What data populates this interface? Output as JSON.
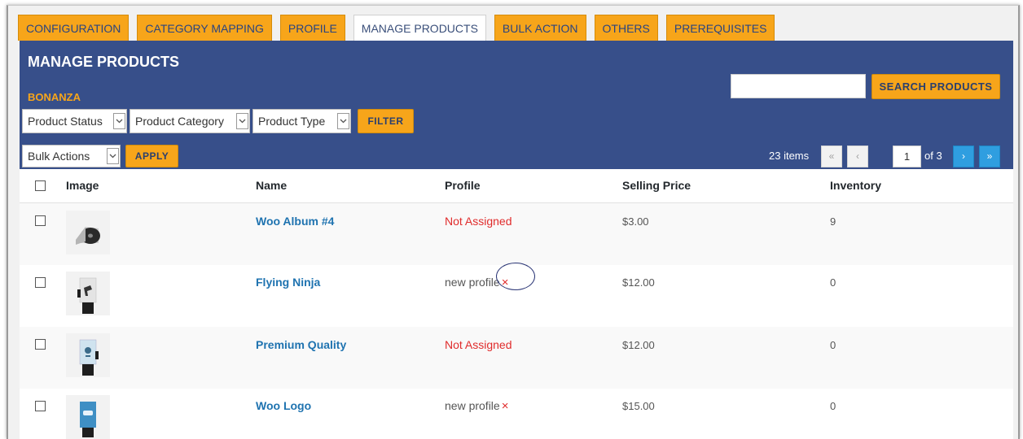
{
  "tabs": [
    {
      "label": "CONFIGURATION"
    },
    {
      "label": "CATEGORY MAPPING"
    },
    {
      "label": "PROFILE"
    },
    {
      "label": "MANAGE PRODUCTS",
      "active": true
    },
    {
      "label": "BULK ACTION"
    },
    {
      "label": "OTHERS"
    },
    {
      "label": "PREREQUISITES"
    }
  ],
  "panel": {
    "title": "MANAGE PRODUCTS",
    "subtitle": "BONANZA",
    "search_value": "",
    "search_button": "SEARCH PRODUCTS",
    "filters": {
      "status": "Product Status",
      "category": "Product Category",
      "type": "Product Type",
      "filter_button": "FILTER"
    },
    "bulk": {
      "select": "Bulk Actions",
      "apply_button": "APPLY"
    },
    "pagination": {
      "items": "23 items",
      "first": "«",
      "prev": "‹",
      "current": "1",
      "of_total": "of 3",
      "next": "›",
      "last": "»"
    }
  },
  "table": {
    "headers": {
      "image": "Image",
      "name": "Name",
      "profile": "Profile",
      "price": "Selling Price",
      "inventory": "Inventory"
    },
    "rows": [
      {
        "name": "Woo Album #4",
        "profile": "Not Assigned",
        "assigned": false,
        "price": "$3.00",
        "inventory": "9",
        "thumb": "album-thumbnail"
      },
      {
        "name": "Flying Ninja",
        "profile": "new profile",
        "assigned": true,
        "remove": "×",
        "price": "$12.00",
        "inventory": "0",
        "thumb": "poster-thumbnail"
      },
      {
        "name": "Premium Quality",
        "profile": "Not Assigned",
        "assigned": false,
        "price": "$12.00",
        "inventory": "0",
        "thumb": "poster-thumbnail"
      },
      {
        "name": "Woo Logo",
        "profile": "new profile",
        "assigned": true,
        "remove": "×",
        "price": "$15.00",
        "inventory": "0",
        "thumb": "poster-thumbnail"
      }
    ]
  },
  "colors": {
    "tab_orange": "#f7a51a",
    "panel_blue": "#374f8a",
    "link_blue": "#1f73b0",
    "not_assigned_red": "#e02b2b"
  }
}
